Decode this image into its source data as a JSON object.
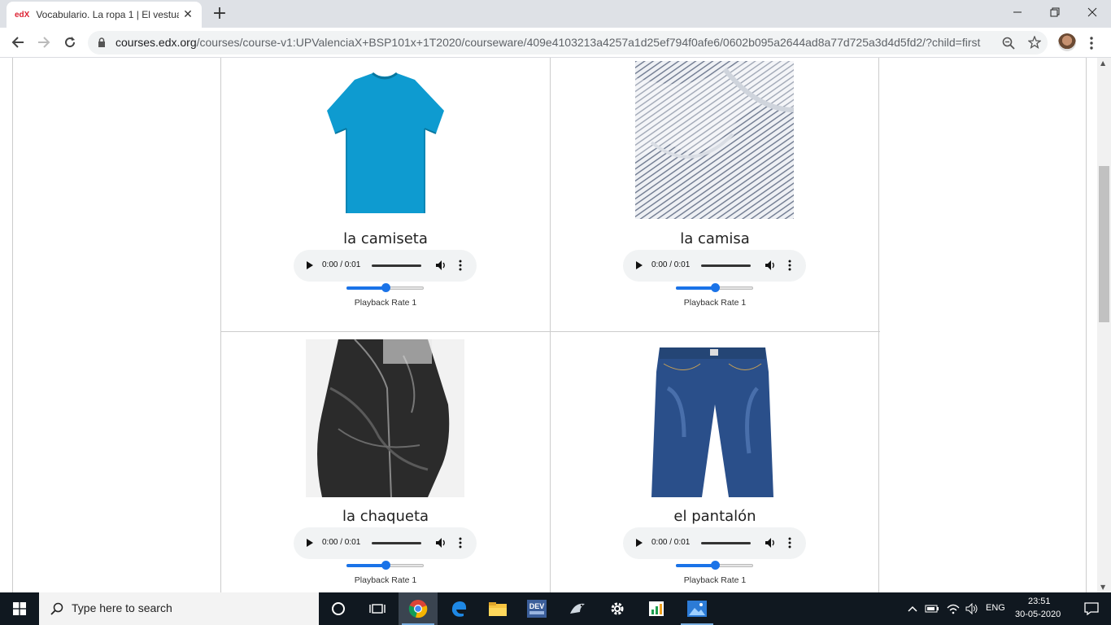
{
  "browser": {
    "tab_title": "Vocabulario. La ropa 1 | El vestua",
    "favicon_text": "edX",
    "url_host": "courses.edx.org",
    "url_path": "/courses/course-v1:UPValenciaX+BSP101x+1T2020/courseware/409e4103213a4257a1d25ef794f0afe6/0602b095a2644ad8a77d725a3d4d5fd2/?child=first"
  },
  "items": [
    {
      "word": "la camiseta",
      "time": "0:00 / 0:01",
      "rate_label": "Playback Rate 1",
      "rate_value": 1,
      "image": "blue-tshirt"
    },
    {
      "word": "la camisa",
      "time": "0:00 / 0:01",
      "rate_label": "Playback Rate 1",
      "rate_value": 1,
      "image": "striped-shirt"
    },
    {
      "word": "la chaqueta",
      "time": "0:00 / 0:01",
      "rate_label": "Playback Rate 1",
      "rate_value": 1,
      "image": "leather-jacket"
    },
    {
      "word": "el pantalón",
      "time": "0:00 / 0:01",
      "rate_label": "Playback Rate 1",
      "rate_value": 1,
      "image": "blue-jeans"
    }
  ],
  "taskbar": {
    "search_placeholder": "Type here to search",
    "language": "ENG",
    "time": "23:51",
    "date": "30-05-2020",
    "dev_label": "DEV"
  },
  "colors": {
    "accent": "#1a73e8",
    "tshirt": "#0e9bd0",
    "jeans": "#2a4f8a",
    "taskbar": "#101820"
  }
}
